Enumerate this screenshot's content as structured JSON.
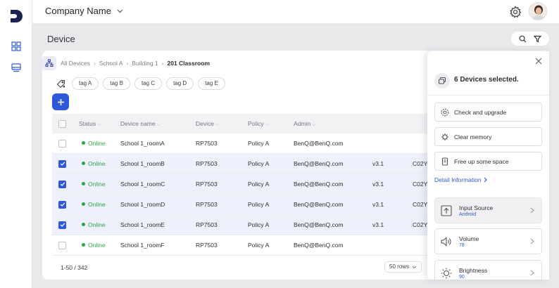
{
  "topbar": {
    "company_name": "Company Name"
  },
  "page": {
    "title": "Device"
  },
  "breadcrumb": [
    "All Devices",
    "School A",
    "Building 1",
    "201 Classroom"
  ],
  "tags": [
    "tag A",
    "tag B",
    "tag C",
    "tag D",
    "tag E"
  ],
  "table": {
    "columns": {
      "status": "Status",
      "device_name": "Device name",
      "device": "Device",
      "policy": "Policy",
      "admin": "Admin"
    },
    "rows": [
      {
        "status": "Online",
        "name": "School 1_roomA",
        "device": "RP7503",
        "policy": "Policy A",
        "admin": "BenQ@BenQ.com",
        "version": "",
        "code": ""
      },
      {
        "status": "Online",
        "name": "School 1_roomB",
        "device": "RP7503",
        "policy": "Policy A",
        "admin": "BenQ@BenQ.com",
        "version": "v3.1",
        "code": "C02Y"
      },
      {
        "status": "Online",
        "name": "School 1_roomC",
        "device": "RP7503",
        "policy": "Policy A",
        "admin": "BenQ@BenQ.com",
        "version": "v3.1",
        "code": "C02Y"
      },
      {
        "status": "Online",
        "name": "School 1_roomD",
        "device": "RP7503",
        "policy": "Policy A",
        "admin": "BenQ@BenQ.com",
        "version": "v3.1",
        "code": "C02Y"
      },
      {
        "status": "Online",
        "name": "School 1_roomE",
        "device": "RP7503",
        "policy": "Policy A",
        "admin": "BenQ@BenQ.com",
        "version": "v3.1",
        "code": "C02Y"
      },
      {
        "status": "Online",
        "name": "School 1_roomF",
        "device": "RP7503",
        "policy": "Policy A",
        "admin": "BenQ@BenQ.com",
        "version": "",
        "code": ""
      }
    ]
  },
  "pagination": {
    "range": "1-50 / 342",
    "rows_per_page": "50 rows"
  },
  "panel": {
    "selected_text": "6 Devices selected.",
    "actions": [
      "Check and upgrade",
      "Clear memory",
      "Free up some space"
    ],
    "detail_link": "Detail Information",
    "settings": [
      {
        "label": "Input Source",
        "value": "Android"
      },
      {
        "label": "Volume",
        "value": "78"
      },
      {
        "label": "Brightness",
        "value": "90"
      }
    ]
  },
  "colors": {
    "accent": "#2f57d9",
    "online": "#28a745",
    "selected_row": "#eef0fb"
  },
  "icons": [
    "logo-icon",
    "dashboard-icon",
    "device-icon",
    "gear-icon",
    "search-icon",
    "filter-icon",
    "hierarchy-icon",
    "tag-icon",
    "plus-icon",
    "close-icon",
    "devices-icon",
    "upgrade-icon",
    "memory-icon",
    "storage-icon",
    "input-source-icon",
    "volume-icon",
    "brightness-icon",
    "chevron-right-icon",
    "chevron-down-icon"
  ]
}
